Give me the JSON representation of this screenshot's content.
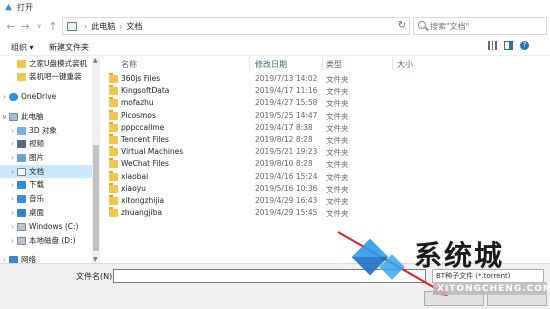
{
  "window": {
    "title": "打开"
  },
  "address": {
    "crumbs": [
      "此电脑",
      "文档"
    ]
  },
  "search": {
    "placeholder": "搜索\"文档\""
  },
  "toolbar": {
    "organize": "组织 ▾",
    "new_folder": "新建文件夹"
  },
  "nav": {
    "items": [
      {
        "label": "之家U盘模式装机",
        "icon": "folder",
        "indent": 1
      },
      {
        "label": "装机吧一键重装",
        "icon": "folder",
        "indent": 1
      },
      {
        "label": "OneDrive",
        "icon": "cloud",
        "indent": 0
      },
      {
        "label": "此电脑",
        "icon": "pc",
        "indent": 0
      },
      {
        "label": "3D 对象",
        "icon": "obj3d",
        "indent": 1
      },
      {
        "label": "视频",
        "icon": "video",
        "indent": 1
      },
      {
        "label": "图片",
        "icon": "pic",
        "indent": 1
      },
      {
        "label": "文档",
        "icon": "doc",
        "indent": 1
      },
      {
        "label": "下载",
        "icon": "down",
        "indent": 1
      },
      {
        "label": "音乐",
        "icon": "music",
        "indent": 1
      },
      {
        "label": "桌面",
        "icon": "desk",
        "indent": 1
      },
      {
        "label": "Windows (C:)",
        "icon": "drive",
        "indent": 1
      },
      {
        "label": "本地磁盘 (D:)",
        "icon": "drive",
        "indent": 1
      },
      {
        "label": "网络",
        "icon": "net",
        "indent": 0
      }
    ]
  },
  "columns": {
    "name": "名称",
    "date": "修改日期",
    "type": "类型",
    "size": "大小"
  },
  "files": [
    {
      "name": "360js Files",
      "date": "2019/7/13 14:02",
      "type": "文件夹"
    },
    {
      "name": "KingsoftData",
      "date": "2019/4/17 11:16",
      "type": "文件夹"
    },
    {
      "name": "mofazhu",
      "date": "2019/4/27 15:58",
      "type": "文件夹"
    },
    {
      "name": "Picosmos",
      "date": "2019/5/25 14:47",
      "type": "文件夹"
    },
    {
      "name": "pppccallme",
      "date": "2019/4/17 8:38",
      "type": "文件夹"
    },
    {
      "name": "Tencent Files",
      "date": "2019/8/12 8:28",
      "type": "文件夹"
    },
    {
      "name": "Virtual Machines",
      "date": "2019/5/21 19:23",
      "type": "文件夹"
    },
    {
      "name": "WeChat Files",
      "date": "2019/8/10 8:28",
      "type": "文件夹"
    },
    {
      "name": "xiaobai",
      "date": "2019/4/16 15:24",
      "type": "文件夹"
    },
    {
      "name": "xiaoyu",
      "date": "2019/5/16 10:36",
      "type": "文件夹"
    },
    {
      "name": "xitongzhijia",
      "date": "2019/4/29 16:43",
      "type": "文件夹"
    },
    {
      "name": "zhuangjiba",
      "date": "2019/4/29 15:45",
      "type": "文件夹"
    }
  ],
  "footer": {
    "filename_label": "文件名(N):",
    "filename_value": "",
    "filetype": "BT种子文件 (*.torrent)",
    "open_label": "",
    "cancel_label": ""
  },
  "watermark": {
    "text": "系统城",
    "url": "XITONGCHENG.COM"
  }
}
